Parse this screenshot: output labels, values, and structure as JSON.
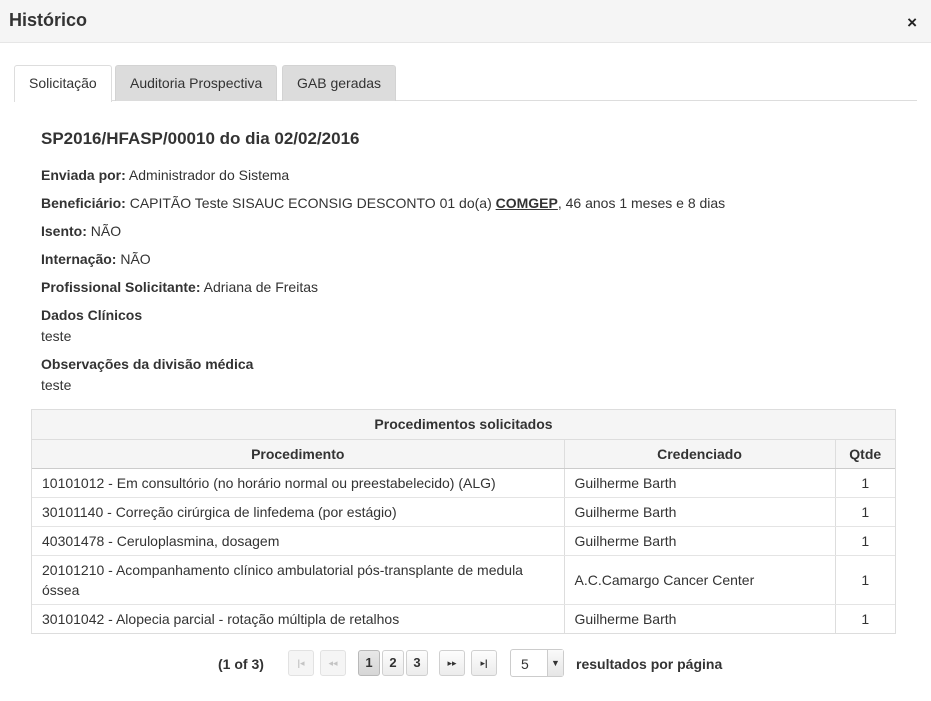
{
  "dialog": {
    "title": "Histórico",
    "close_glyph": "×",
    "close_icon": "close-icon"
  },
  "tabs": [
    {
      "label": "Solicitação",
      "active": true
    },
    {
      "label": "Auditoria Prospectiva",
      "active": false
    },
    {
      "label": "GAB geradas",
      "active": false
    }
  ],
  "request": {
    "title": "SP2016/HFASP/00010 do dia 02/02/2016",
    "sent_by_label": "Enviada por:",
    "sent_by": "Administrador do Sistema",
    "beneficiary_label": "Beneficiário:",
    "beneficiary_prefix": "CAPITÃO Teste SISAUC ECONSIG DESCONTO 01 do(a)",
    "beneficiary_org": "COMGEP",
    "beneficiary_suffix": ", 46 anos 1 meses e 8 dias",
    "exempt_label": "Isento:",
    "exempt": "NÃO",
    "hospitalization_label": "Internação:",
    "hospitalization": "NÃO",
    "requester_label": "Profissional Solicitante:",
    "requester": "Adriana de Freitas",
    "clinical_label": "Dados Clínicos",
    "clinical": "teste",
    "notes_label": "Observações da divisão médica",
    "notes": "teste"
  },
  "procedures": {
    "caption": "Procedimentos solicitados",
    "headers": {
      "procedure": "Procedimento",
      "provider": "Credenciado",
      "qty": "Qtde"
    },
    "rows": [
      {
        "procedure": "10101012 - Em consultório (no horário normal ou preestabelecido) (ALG)",
        "provider": "Guilherme Barth",
        "qty": "1"
      },
      {
        "procedure": "30101140 - Correção cirúrgica de linfedema (por estágio)",
        "provider": "Guilherme Barth",
        "qty": "1"
      },
      {
        "procedure": "40301478 - Ceruloplasmina, dosagem",
        "provider": "Guilherme Barth",
        "qty": "1"
      },
      {
        "procedure": "20101210 - Acompanhamento clínico ambulatorial pós-transplante de medula óssea",
        "provider": "A.C.Camargo Cancer Center",
        "qty": "1"
      },
      {
        "procedure": "30101042 - Alopecia parcial - rotação múltipla de retalhos",
        "provider": "Guilherme Barth",
        "qty": "1"
      }
    ]
  },
  "paginator": {
    "info": "(1 of 3)",
    "first": "|◂",
    "prev": "◂◂",
    "pages": [
      "1",
      "2",
      "3"
    ],
    "current_page": "1",
    "next": "▸▸",
    "last": "▸|",
    "rows_per_page": "5",
    "rows_per_page_suffix": "resultados por página"
  }
}
